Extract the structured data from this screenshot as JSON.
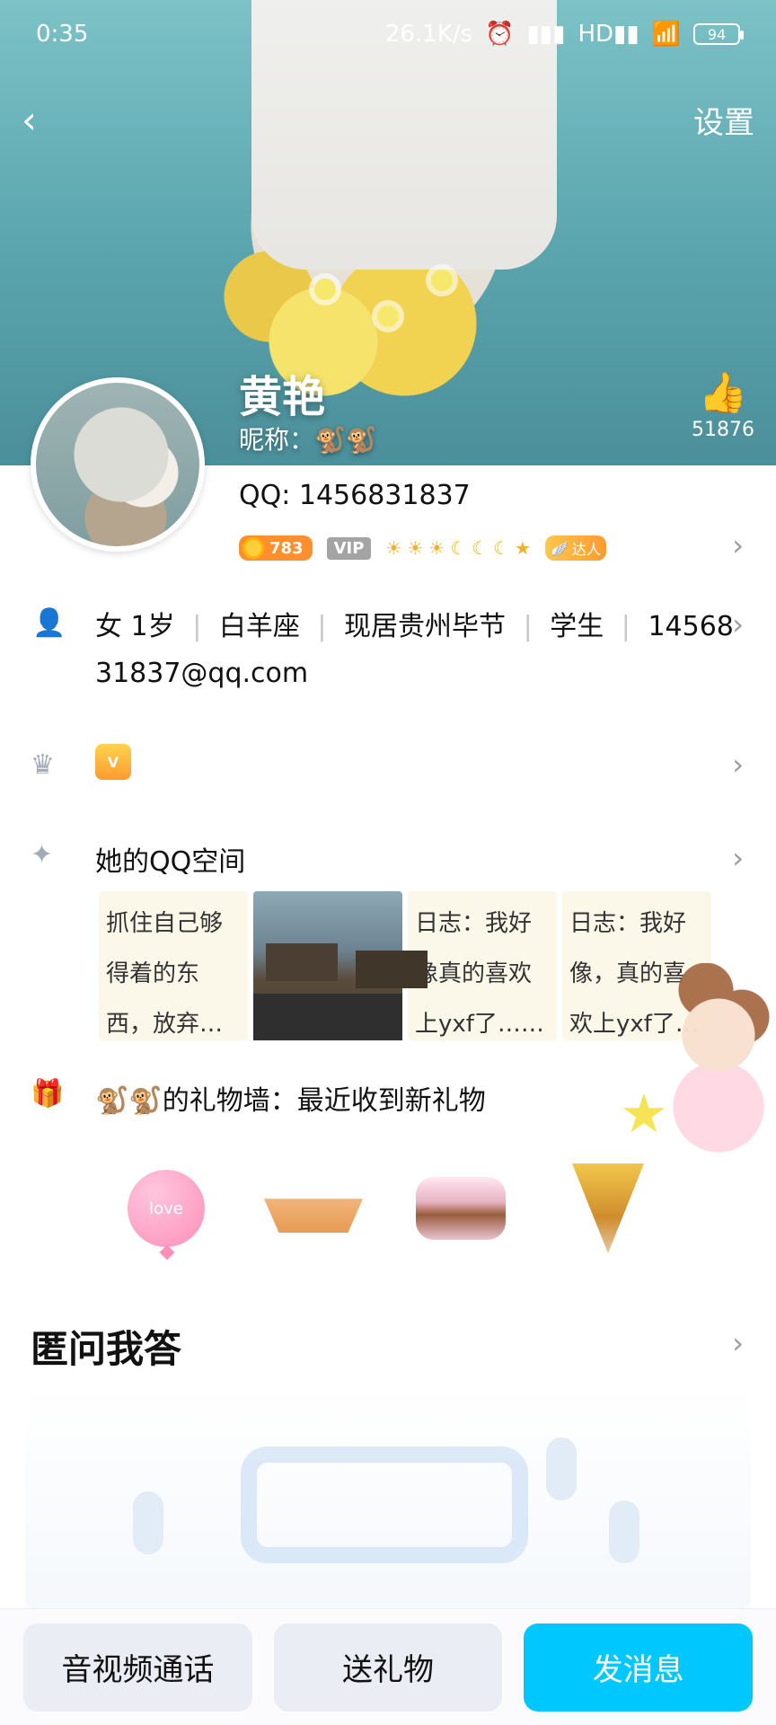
{
  "status_bar": {
    "time": "0:35",
    "network_speed": "26.1K/s",
    "battery": "94",
    "icons": [
      "alarm-icon",
      "signal-icon",
      "hd-signal-icon",
      "wifi-icon",
      "battery-icon"
    ]
  },
  "header": {
    "back_icon": "chevron-left-icon",
    "settings_label": "设置",
    "name": "黄艳",
    "nickname_label": "昵称：🐒🐒",
    "likes_count": "51876"
  },
  "profile": {
    "qq_label": "QQ: 1456831837",
    "coin_level": "783",
    "vip_label": "VIP",
    "levels": [
      "☀",
      "☀",
      "☀",
      "☾",
      "☾",
      "☾",
      "★"
    ],
    "expert_label": "达人"
  },
  "info": {
    "gender": "女",
    "age": "1岁",
    "zodiac": "白羊座",
    "location": "现居贵州毕节",
    "occupation": "学生",
    "email_part1": "14568",
    "email_part2": "31837@qq.com"
  },
  "vip_medal": {
    "label": "V"
  },
  "qq_space": {
    "title": "她的QQ空间",
    "cards": [
      {
        "text": "抓住自己够得着的东西，放弃…"
      },
      {
        "text": ""
      },
      {
        "text": "日志：我好像真的喜欢上yxf了……"
      },
      {
        "text": "日志：我好像，真的喜欢上yxf了…"
      }
    ]
  },
  "gift_wall": {
    "title": "🐒🐒的礼物墙：最近收到新礼物",
    "balloon_text": "love"
  },
  "qa_section": {
    "title": "匿问我答"
  },
  "bottom_bar": {
    "call_label": "音视频通话",
    "gift_label": "送礼物",
    "message_label": "发消息"
  },
  "colors": {
    "primary": "#00c8ff",
    "button_bg": "#eaedf4",
    "icon_gray": "#a5aab7"
  }
}
